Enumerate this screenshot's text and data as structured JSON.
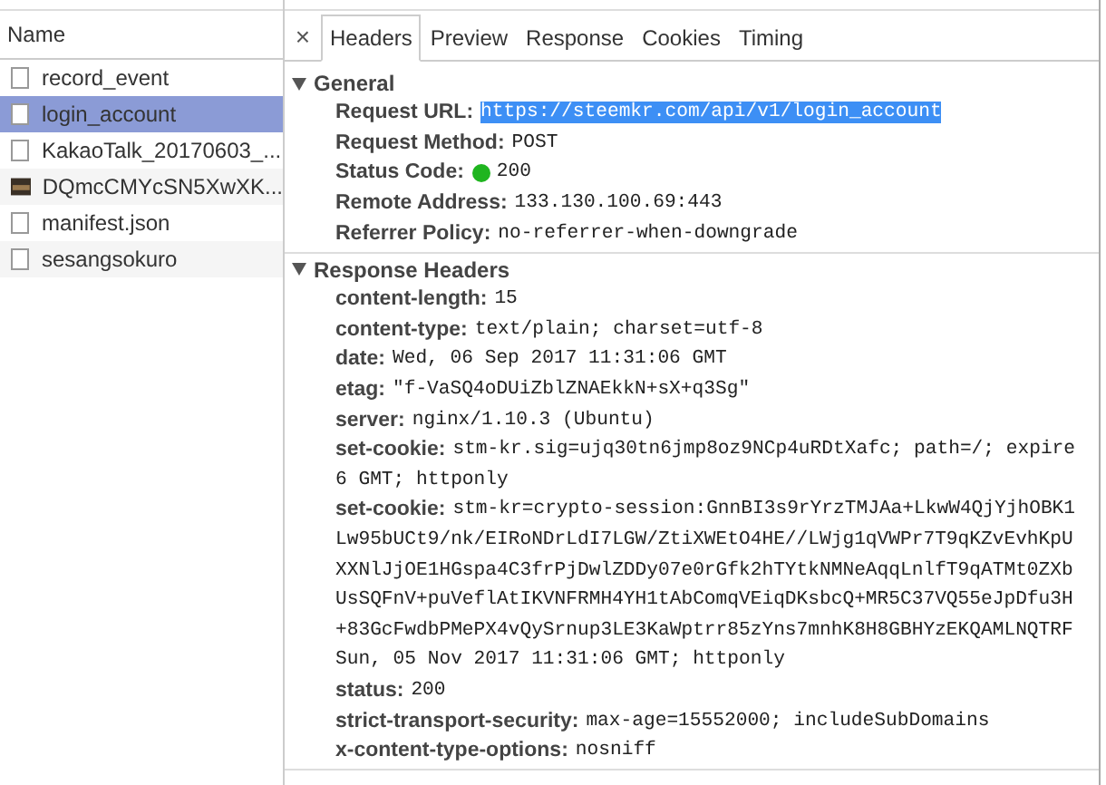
{
  "sidebar": {
    "column_header": "Name",
    "items": [
      {
        "name": "record_event",
        "kind": "document",
        "selected": false
      },
      {
        "name": "login_account",
        "kind": "document",
        "selected": true
      },
      {
        "name": "KakaoTalk_20170603_...",
        "kind": "document",
        "selected": false
      },
      {
        "name": "DQmcCMYcSN5XwXK...",
        "kind": "image",
        "selected": false
      },
      {
        "name": "manifest.json",
        "kind": "document",
        "selected": false
      },
      {
        "name": "sesangsokuro",
        "kind": "document",
        "selected": false
      }
    ]
  },
  "close_button": "×",
  "tabs": [
    {
      "label": "Headers",
      "selected": true
    },
    {
      "label": "Preview",
      "selected": false
    },
    {
      "label": "Response",
      "selected": false
    },
    {
      "label": "Cookies",
      "selected": false
    },
    {
      "label": "Timing",
      "selected": false
    }
  ],
  "sections": [
    {
      "title": "General",
      "expanded": true,
      "rows": [
        {
          "name": "Request URL:",
          "value": "https://steemkr.com/api/v1/login_account",
          "highlighted": true
        },
        {
          "name": "Request Method:",
          "value": "POST",
          "highlighted": false
        },
        {
          "name": "Status Code:",
          "value": "200",
          "highlighted": false,
          "status_dot": true
        },
        {
          "name": "Remote Address:",
          "value": "133.130.100.69:443",
          "highlighted": false
        },
        {
          "name": "Referrer Policy:",
          "value": "no-referrer-when-downgrade",
          "highlighted": false
        }
      ]
    },
    {
      "title": "Response Headers",
      "expanded": true,
      "rows": [
        {
          "name": "content-length:",
          "value": "15",
          "highlighted": false
        },
        {
          "name": "content-type:",
          "value": "text/plain; charset=utf-8",
          "highlighted": false
        },
        {
          "name": "date:",
          "value": "Wed, 06 Sep 2017 11:31:06 GMT",
          "highlighted": false
        },
        {
          "name": "etag:",
          "value": "\"f-VaSQ4oDUiZblZNAEkkN+sX+q3Sg\"",
          "highlighted": false
        },
        {
          "name": "server:",
          "value": "nginx/1.10.3 (Ubuntu)",
          "highlighted": false
        },
        {
          "name": "set-cookie:",
          "value": "stm-kr.sig=ujq30tn6jmp8oz9NCp4uRDtXafc; path=/; expire",
          "highlighted": false,
          "continuation": [
            "6 GMT; httponly"
          ]
        },
        {
          "name": "set-cookie:",
          "value": "stm-kr=crypto-session:GnnBI3s9rYrzTMJAa+LkwW4QjYjhOBK1",
          "highlighted": false,
          "continuation": [
            "Lw95bUCt9/nk/EIRoNDrLdI7LGW/ZtiXWEtO4HE//LWjg1qVWPr7T9qKZvEvhKpU",
            "XXNlJjOE1HGspa4C3frPjDwlZDDy07e0rGfk2hTYtkNMNeAqqLnlfT9qATMt0ZXb",
            "UsSQFnV+puVeflAtIKVNFRMH4YH1tAbComqVEiqDKsbcQ+MR5C37VQ55eJpDfu3H",
            "+83GcFwdbPMePX4vQySrnup3LE3KaWptrr85zYns7mnhK8H8GBHYzEKQAMLNQTRF",
            "Sun, 05 Nov 2017 11:31:06 GMT; httponly"
          ]
        },
        {
          "name": "status:",
          "value": "200",
          "highlighted": false
        },
        {
          "name": "strict-transport-security:",
          "value": "max-age=15552000; includeSubDomains",
          "highlighted": false
        },
        {
          "name": "x-content-type-options:",
          "value": "nosniff",
          "highlighted": false
        }
      ]
    }
  ]
}
